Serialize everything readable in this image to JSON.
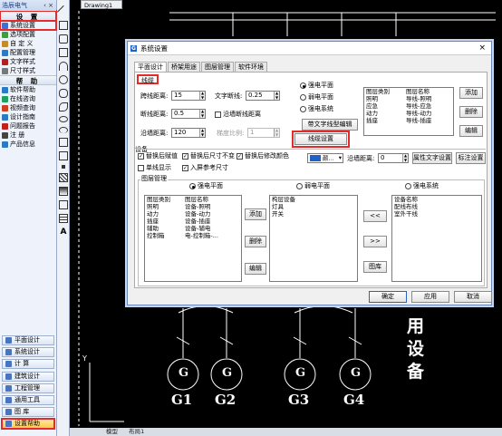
{
  "left_panel": {
    "title": "浩辰电气",
    "title_controls": "‹ ×",
    "header_settings": "设    置",
    "settings_items": [
      {
        "label": "系统设置",
        "icon": "gear-icon",
        "color": "#3e6fd1"
      },
      {
        "label": "选项配置",
        "icon": "check-icon",
        "color": "#3e9e3e"
      },
      {
        "label": "自 定 义",
        "icon": "pencil-icon",
        "color": "#c78b1f"
      },
      {
        "label": "配置管理",
        "icon": "folder-icon",
        "color": "#2a7ac6"
      },
      {
        "label": "文字样式",
        "icon": "text-icon",
        "color": "#b02020"
      },
      {
        "label": "尺寸样式",
        "icon": "ruler-icon",
        "color": "#777"
      }
    ],
    "header_help": "帮    助",
    "help_items": [
      {
        "label": "软件帮助",
        "icon": "help-icon",
        "color": "#2a7ac6"
      },
      {
        "label": "在线咨询",
        "icon": "chat-icon",
        "color": "#20a060"
      },
      {
        "label": "视频查询",
        "icon": "video-icon",
        "color": "#d04020"
      },
      {
        "label": "设计指南",
        "icon": "book-icon",
        "color": "#2a7ac6"
      },
      {
        "label": "问题报告",
        "icon": "report-icon",
        "color": "#c02020"
      }
    ],
    "extra_items": [
      {
        "label": "注    册",
        "icon": "key-icon",
        "color": "#444"
      },
      {
        "label": "产品信息",
        "icon": "info-icon",
        "color": "#2a7ac6"
      }
    ],
    "bottom_buttons": [
      {
        "label": "平面设计",
        "icon": "plan-icon"
      },
      {
        "label": "系统设计",
        "icon": "system-icon"
      },
      {
        "label": "计    算",
        "icon": "calc-icon"
      },
      {
        "label": "建筑设计",
        "icon": "building-icon"
      },
      {
        "label": "工程管理",
        "icon": "project-icon"
      },
      {
        "label": "通用工具",
        "icon": "tools-icon"
      },
      {
        "label": "图    库",
        "icon": "library-icon"
      },
      {
        "label": "设置帮助",
        "icon": "settings-help-icon",
        "active": true
      }
    ]
  },
  "canvas": {
    "doc_tab": "Drawing1",
    "generators": [
      "G1",
      "G2",
      "G3",
      "G4"
    ],
    "gen_symbol": "G",
    "side_text": [
      "用",
      "设",
      "备"
    ],
    "bottom_tabs": [
      "模型",
      "布局1"
    ],
    "axis_y": "Y"
  },
  "dialog": {
    "title": "系统设置",
    "close": "×",
    "tabs": [
      "平面设计",
      "桥架用途",
      "图层管理",
      "软件环境"
    ],
    "sub_tab": "线缆",
    "fields": {
      "span_label": "跨线距离:",
      "span_value": "15",
      "break_label": "断线距离:",
      "break_value": "0.5",
      "wall_label": "沿墙距离:",
      "wall_value": "120",
      "text_line_label": "文字断线:",
      "text_line_value": "0.25",
      "along_wall_break": "沿墙断线距离",
      "pitch_label": "梯度比例:",
      "pitch_value": "1"
    },
    "radio_top": [
      "强电平面",
      "弱电平面",
      "强电系统"
    ],
    "btn_text_style": "带文字线型编辑",
    "btn_cable_setting": "线缆设置",
    "top_list": {
      "headers": [
        "图层类别",
        "图层名称"
      ],
      "rows": [
        [
          "照明",
          "导线-照明"
        ],
        [
          "应急",
          "导线-应急"
        ],
        [
          "动力",
          "导线-动力"
        ],
        [
          "插座",
          "导线-插座"
        ]
      ]
    },
    "top_buttons": [
      "添加",
      "删除",
      "编辑"
    ],
    "equip_group": "设备",
    "equip_checks": [
      {
        "label": "替换后赋值",
        "checked": true
      },
      {
        "label": "替换后尺寸不变",
        "checked": true
      },
      {
        "label": "替换后修改颜色",
        "checked": true
      },
      {
        "label": "单线显示",
        "checked": false
      },
      {
        "label": "入屏参考尺寸",
        "checked": true
      }
    ],
    "color_label": "颜...",
    "along_wall_label": "沿墙距离:",
    "along_wall_value": "0",
    "btn_attr_text": "属性文字设置",
    "btn_label_setting": "标注设置",
    "layer_group": "图层管理",
    "radio_layer": [
      "强电平面",
      "弱电平面",
      "强电系统"
    ],
    "layer_list": {
      "headers": [
        "图层类别",
        "图层名称"
      ],
      "rows": [
        [
          "照明",
          "设备-照明"
        ],
        [
          "动力",
          "设备-动力"
        ],
        [
          "插座",
          "设备-插座"
        ],
        [
          "辅助",
          "设备-辅电"
        ],
        [
          "控制箱",
          "电-控制箱-..."
        ]
      ]
    },
    "layer_buttons": [
      "添加",
      "删除",
      "编辑"
    ],
    "mid_list": {
      "header": "构层设备",
      "rows": [
        "灯具",
        "开关"
      ]
    },
    "arrow_buttons": [
      "<<",
      ">>",
      "图库"
    ],
    "right_list": {
      "header": "设备名称",
      "rows": [
        "配线布线",
        "室外干线"
      ]
    },
    "footer_buttons": [
      "确定",
      "应用",
      "取消"
    ]
  }
}
